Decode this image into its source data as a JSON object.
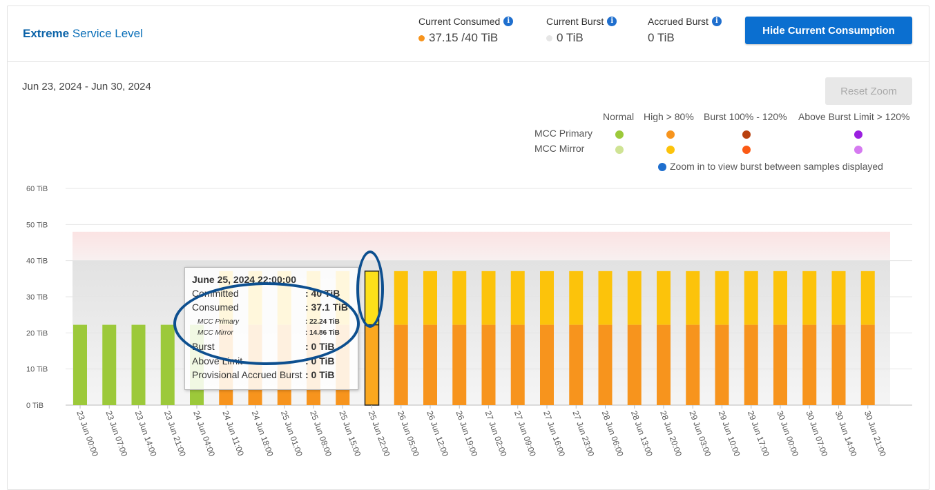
{
  "header": {
    "title_bold": "Extreme",
    "title_rest": " Service Level",
    "current_consumed_label": "Current Consumed",
    "current_consumed_value": "37.15 /40 TiB",
    "current_burst_label": "Current Burst",
    "current_burst_value": "0 TiB",
    "accrued_burst_label": "Accrued Burst",
    "accrued_burst_value": "0 TiB",
    "hide_button": "Hide Current Consumption",
    "info_glyph": "i",
    "icons": [
      "info-icon"
    ],
    "colors": {
      "consumed_dot": "#f7941d",
      "burst_dot": "#e6e6e6",
      "accent": "#0b6fd0"
    }
  },
  "date_range": "Jun 23, 2024 - Jun 30, 2024",
  "reset_zoom": "Reset Zoom",
  "legend": {
    "columns": [
      "Normal",
      "High > 80%",
      "Burst 100% - 120%",
      "Above Burst Limit > 120%"
    ],
    "rows": [
      {
        "label": "MCC Primary",
        "colors": [
          "#9cc93a",
          "#f7941d",
          "#b8400e",
          "#9a1fe0"
        ]
      },
      {
        "label": "MCC Mirror",
        "colors": [
          "#cfe394",
          "#fcc30b",
          "#fb5a14",
          "#d57af0"
        ]
      }
    ],
    "note": "Zoom in to view burst between samples displayed",
    "note_color": "#1f6fce"
  },
  "tooltip": {
    "title": "June 25, 2024 22:00:00",
    "rows": [
      {
        "label": "Committed",
        "value": ": 40 TiB",
        "small": false
      },
      {
        "label": "Consumed",
        "value": ": 37.1 TiB",
        "small": false
      },
      {
        "label": "MCC Primary",
        "value": ": 22.24 TiB",
        "small": true
      },
      {
        "label": "MCC Mirror",
        "value": ": 14.86 TiB",
        "small": true
      },
      {
        "label": "Burst",
        "value": ": 0 TiB",
        "small": false
      },
      {
        "label": "Above Limit",
        "value": ": 0 TiB",
        "small": false
      },
      {
        "label": "Provisional Accrued Burst",
        "value": ": 0 TiB",
        "small": false
      }
    ]
  },
  "chart_data": {
    "type": "bar",
    "stacked": true,
    "ylim": [
      0,
      60
    ],
    "yticks": [
      "0 TiB",
      "10 TiB",
      "20 TiB",
      "30 TiB",
      "40 TiB",
      "50 TiB",
      "60 TiB"
    ],
    "committed": 40,
    "burst_limit": 48,
    "categories": [
      "23 Jun 00:00",
      "23 Jun 07:00",
      "23 Jun 14:00",
      "23 Jun 21:00",
      "24 Jun 04:00",
      "24 Jun 11:00",
      "24 Jun 18:00",
      "25 Jun 01:00",
      "25 Jun 08:00",
      "25 Jun 15:00",
      "25 Jun 22:00",
      "26 Jun 05:00",
      "26 Jun 12:00",
      "26 Jun 19:00",
      "27 Jun 02:00",
      "27 Jun 09:00",
      "27 Jun 16:00",
      "27 Jun 23:00",
      "28 Jun 06:00",
      "28 Jun 13:00",
      "28 Jun 20:00",
      "29 Jun 03:00",
      "29 Jun 10:00",
      "29 Jun 17:00",
      "30 Jun 00:00",
      "30 Jun 07:00",
      "30 Jun 14:00",
      "30 Jun 21:00"
    ],
    "series": [
      {
        "name": "MCC Primary",
        "values": [
          22.24,
          22.24,
          22.24,
          22.24,
          22.24,
          22.24,
          22.24,
          22.24,
          22.24,
          22.24,
          22.24,
          22.24,
          22.24,
          22.24,
          22.24,
          22.24,
          22.24,
          22.24,
          22.24,
          22.24,
          22.24,
          22.24,
          22.24,
          22.24,
          22.24,
          22.24,
          22.24,
          22.24
        ]
      },
      {
        "name": "MCC Mirror",
        "values": [
          0,
          0,
          0,
          0,
          0,
          14.86,
          14.86,
          14.86,
          14.86,
          14.86,
          14.86,
          14.86,
          14.86,
          14.86,
          14.86,
          14.86,
          14.86,
          14.86,
          14.86,
          14.86,
          14.86,
          14.86,
          14.86,
          14.86,
          14.86,
          14.86,
          14.86,
          14.86
        ]
      }
    ],
    "highlighted_index": 10
  }
}
